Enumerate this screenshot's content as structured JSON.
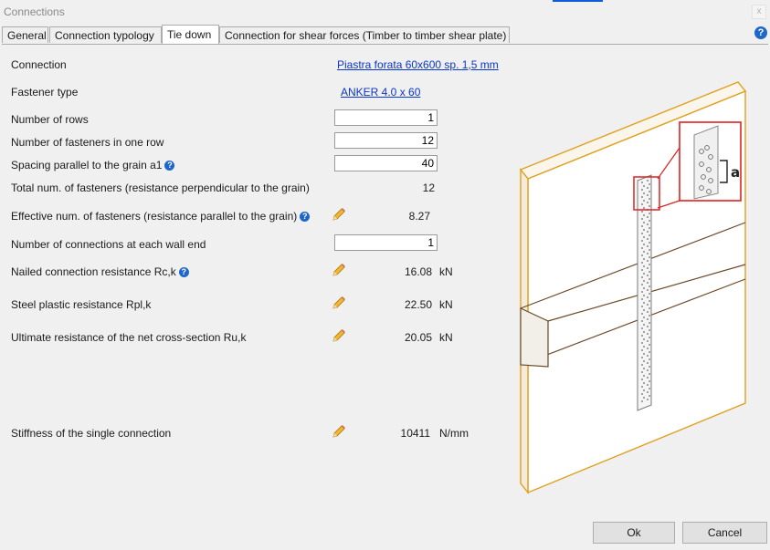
{
  "window": {
    "title": "Connections",
    "close_label": "x"
  },
  "tabs": [
    {
      "label": "General"
    },
    {
      "label": "Connection typology"
    },
    {
      "label": "Tie down"
    },
    {
      "label": "Connection for shear forces (Timber to timber shear plate)"
    }
  ],
  "help_icon": "?",
  "fields": {
    "connection": {
      "label": "Connection",
      "link": "Piastra forata 60x600 sp. 1,5 mm"
    },
    "fastener_type": {
      "label": "Fastener type",
      "link": "ANKER 4.0 x 60"
    },
    "rows": {
      "label": "Number of rows",
      "value": "1"
    },
    "fasteners_per_row": {
      "label": "Number of fasteners in one row",
      "value": "12"
    },
    "spacing": {
      "label": "Spacing parallel to the grain a1",
      "value": "40"
    },
    "total_fasteners": {
      "label": "Total num. of fasteners (resistance perpendicular to the grain)",
      "value": "12"
    },
    "effective_fasteners": {
      "label": "Effective num. of fasteners (resistance parallel to the grain)",
      "value": "8.27"
    },
    "connections_each_end": {
      "label": "Number of connections at each wall end",
      "value": "1"
    },
    "nailed_resistance": {
      "label": "Nailed connection resistance  Rc,k",
      "value": "16.08",
      "unit": "kN"
    },
    "steel_plastic": {
      "label": "Steel plastic resistance Rpl,k",
      "value": "22.50",
      "unit": "kN"
    },
    "ultimate_resistance": {
      "label": "Ultimate resistance of the net cross-section Ru,k",
      "value": "20.05",
      "unit": "kN"
    },
    "stiffness": {
      "label": "Stiffness of the single connection",
      "value": "10411",
      "unit": "N/mm"
    }
  },
  "drawing": {
    "detail_label": "a"
  },
  "buttons": {
    "ok": "Ok",
    "cancel": "Cancel"
  },
  "icons": {
    "help": "question-circle-icon",
    "edit": "pencil-icon"
  },
  "colors": {
    "wood_outline": "#e0a020",
    "band_outline": "#6b4a2a",
    "highlight": "#e02020",
    "link": "#0a36c8",
    "help": "#1e66c8"
  }
}
